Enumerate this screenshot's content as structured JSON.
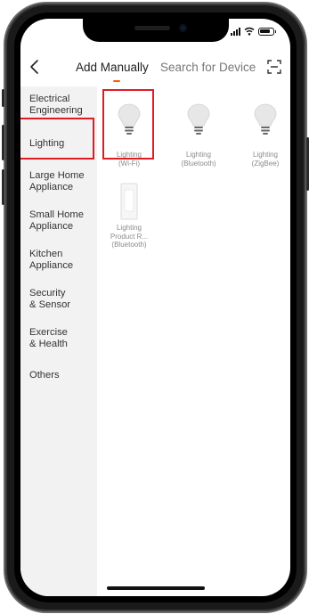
{
  "header": {
    "tabs": [
      {
        "label": "Add Manually"
      },
      {
        "label": "Search for Device"
      }
    ]
  },
  "categories": [
    {
      "label": "Electrical Engineering",
      "lines": [
        "Electrical",
        "Engineering"
      ]
    },
    {
      "label": "Lighting",
      "lines": [
        "Lighting"
      ]
    },
    {
      "label": "Large Home Appliance",
      "lines": [
        "Large Home",
        "Appliance"
      ]
    },
    {
      "label": "Small Home Appliance",
      "lines": [
        "Small Home",
        "Appliance"
      ]
    },
    {
      "label": "Kitchen Appliance",
      "lines": [
        "Kitchen",
        "Appliance"
      ]
    },
    {
      "label": "Security & Sensor",
      "lines": [
        "Security",
        "& Sensor"
      ]
    },
    {
      "label": "Exercise & Health",
      "lines": [
        "Exercise",
        "& Health"
      ]
    },
    {
      "label": "Others",
      "lines": [
        "Others"
      ]
    }
  ],
  "selected_category": "Lighting",
  "devices": [
    {
      "name": "Lighting",
      "protocol": "(Wi-Fi)",
      "icon": "light-bulb-icon"
    },
    {
      "name": "Lighting",
      "protocol": "(Bluetooth)",
      "icon": "light-bulb-icon"
    },
    {
      "name": "Lighting",
      "protocol": "(ZigBee)",
      "icon": "light-bulb-icon"
    },
    {
      "name": "Lighting Product R...",
      "name_lines": [
        "Lighting",
        "Product R..."
      ],
      "protocol": "(Bluetooth)",
      "icon": "light-panel-icon"
    }
  ],
  "colors": {
    "accent": "#ff5a00",
    "highlight": "#e01b24",
    "sidebar_bg": "#f2f2f2"
  },
  "icons": [
    "back-chevron-icon",
    "scan-icon",
    "signal-icon",
    "wifi-icon",
    "battery-icon"
  ]
}
